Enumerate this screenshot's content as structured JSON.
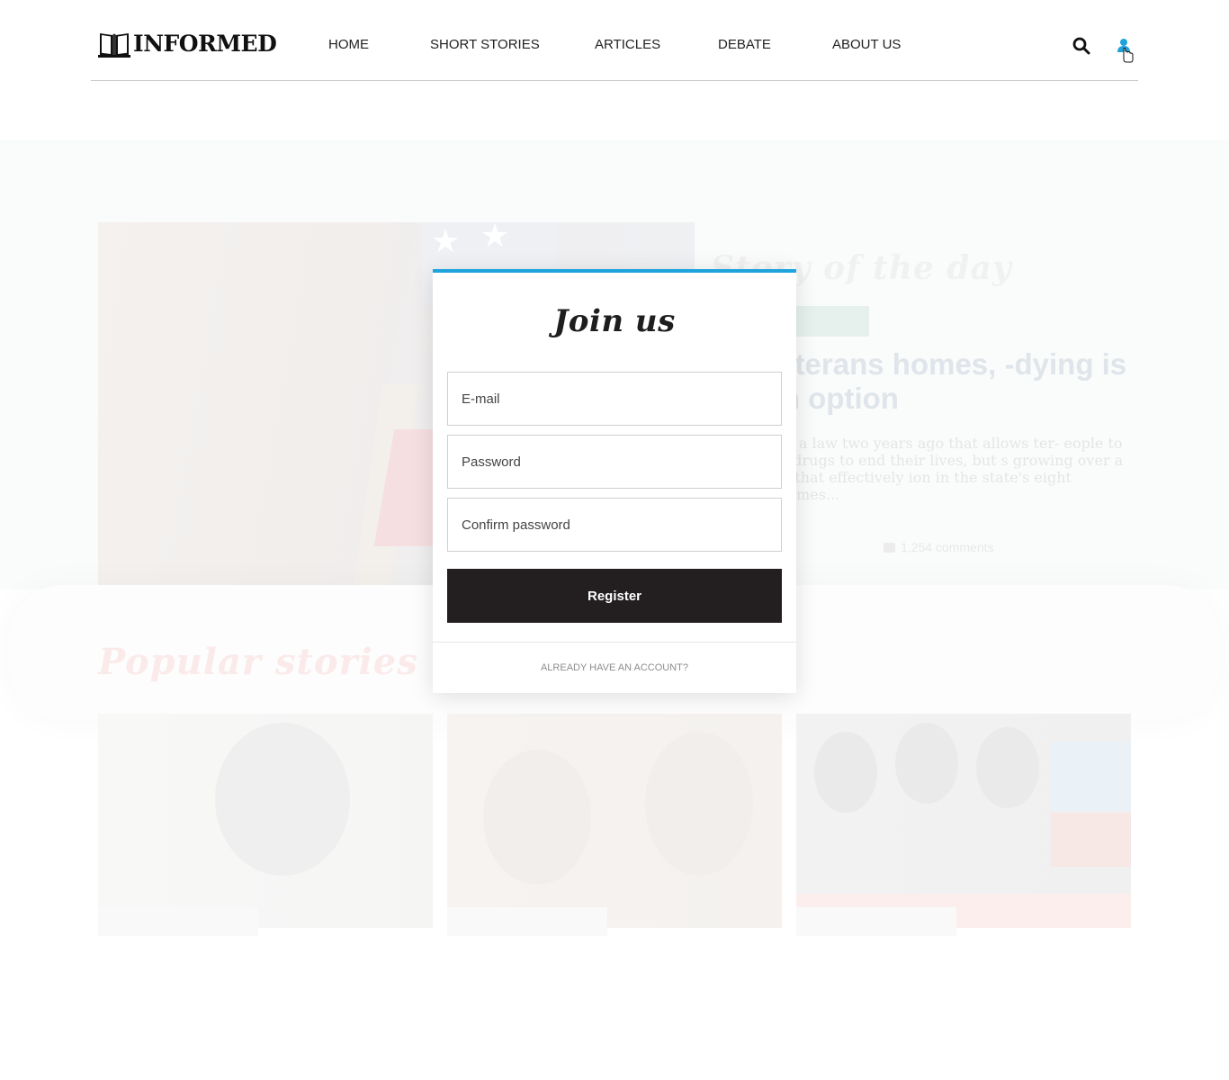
{
  "brand": {
    "name": "INFORMED"
  },
  "nav": {
    "items": [
      {
        "label": "HOME"
      },
      {
        "label": "SHORT STORIES"
      },
      {
        "label": "ARTICLES"
      },
      {
        "label": "DEBATE"
      },
      {
        "label": "ABOUT US"
      }
    ]
  },
  "header": {
    "search_icon": "search-icon",
    "user_icon": "user-icon",
    "accent": "#1fa3dc"
  },
  "story_of_day": {
    "label": "Story of the day",
    "title": "me veterans homes, -dying is not an option",
    "excerpt": "ters passed a law two years ago that allows ter- eople to take lethal drugs to end their lives, but s growing over a newer rule that effectively ion in the state's eight veterans homes...",
    "comments": "1,254 comments"
  },
  "popular": {
    "label": "Popular stories",
    "cards": [
      {
        "title": ""
      },
      {
        "title": ""
      },
      {
        "title": ""
      }
    ]
  },
  "modal": {
    "title": "Join us",
    "email_placeholder": "E-mail",
    "password_placeholder": "Password",
    "confirm_placeholder": "Confirm password",
    "register_label": "Register",
    "login_link": "ALREADY HAVE AN ACCOUNT?",
    "accent": "#1fa3dc",
    "button_color": "#231f20"
  }
}
